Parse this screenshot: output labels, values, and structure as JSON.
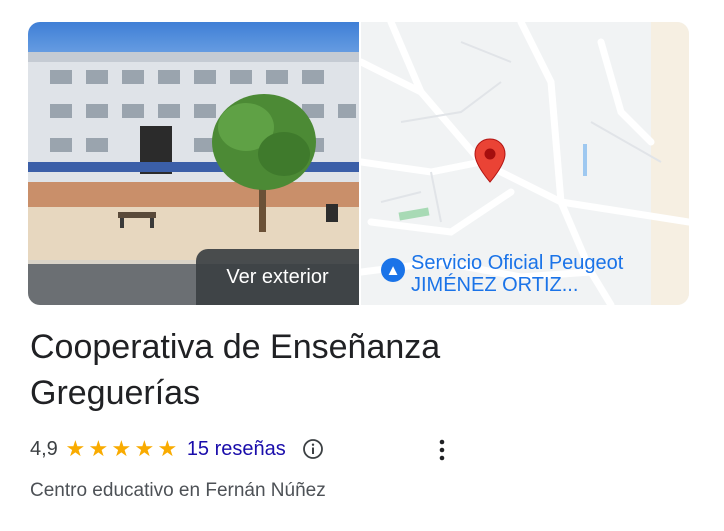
{
  "place": {
    "name": "Cooperativa de Enseñanza Greguerías",
    "rating": "4,9",
    "stars": 5,
    "reviews_label": "15 reseñas",
    "category": "Centro educativo en Fernán Núñez"
  },
  "photo": {
    "exterior_button": "Ver exterior"
  },
  "map": {
    "poi_line1": "Servicio Oficial Peugeot",
    "poi_line2": "JIMÉNEZ ORTIZ...",
    "poi_icon": "car-icon",
    "pin_icon": "map-pin-icon"
  },
  "colors": {
    "star": "#f9ab00",
    "link": "#1a0dab",
    "map_label": "#1a73e8",
    "pin": "#ea4335"
  }
}
